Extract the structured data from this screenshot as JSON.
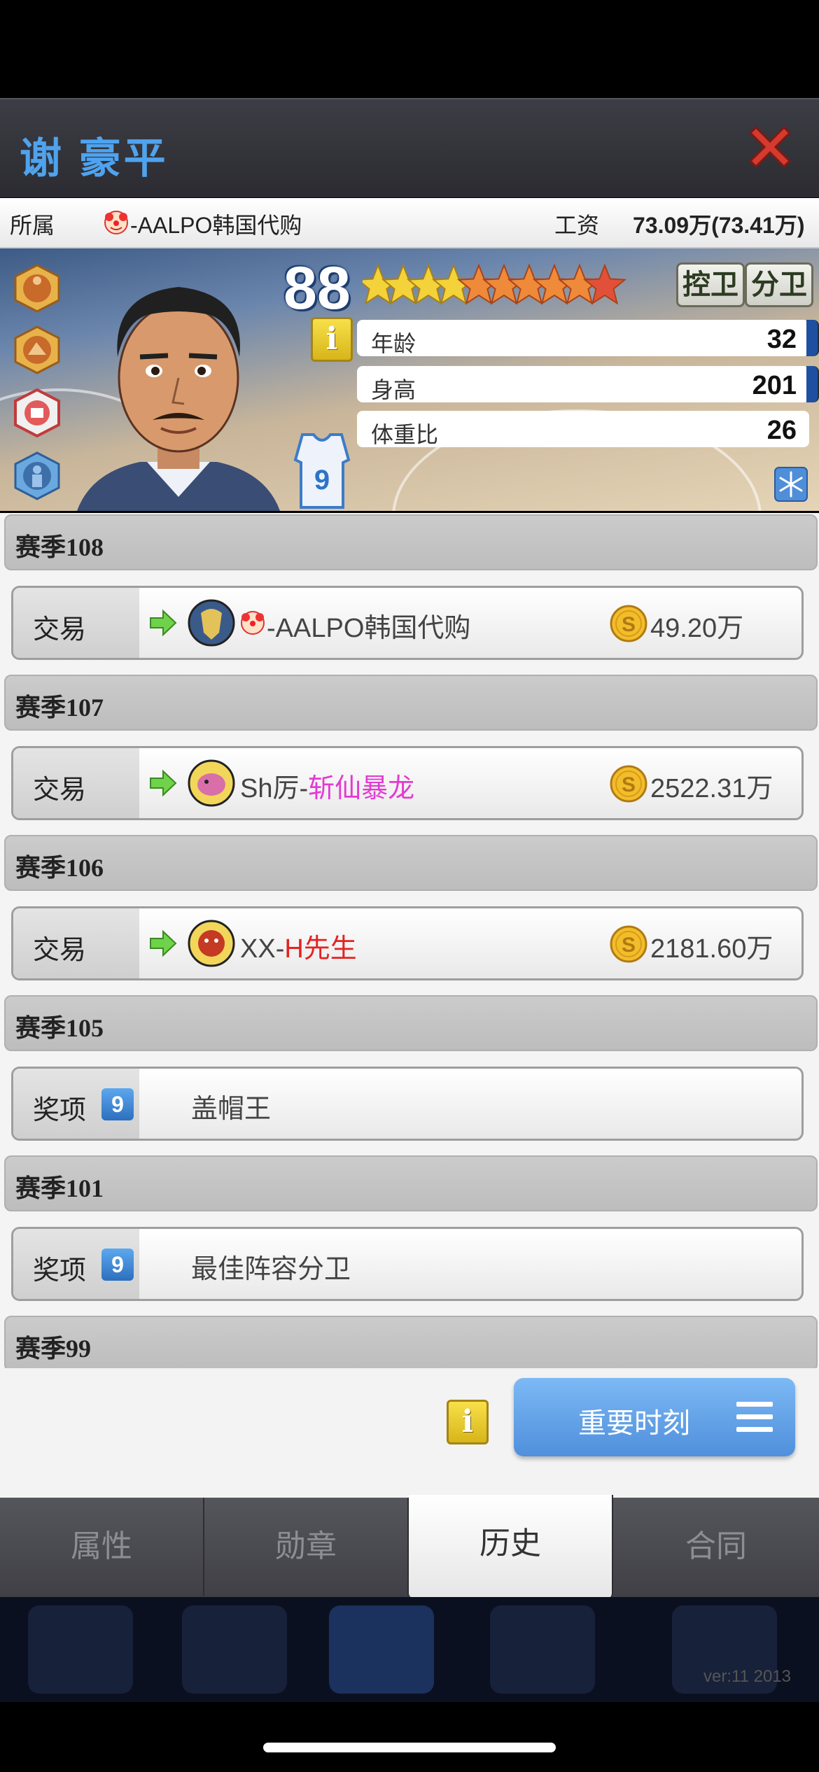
{
  "header": {
    "title": "谢 豪平",
    "close_icon": "close-x-icon"
  },
  "info": {
    "team_label": "所属",
    "team_name": "-AALPO韩国代购",
    "salary_label": "工资",
    "salary_value": "73.09万(73.41万)"
  },
  "player": {
    "overall": "88",
    "stars_total": 10,
    "positions": [
      "控卫",
      "分卫"
    ],
    "jersey_number": "9",
    "stats": [
      {
        "label": "年龄",
        "value": "32"
      },
      {
        "label": "身高",
        "value": "201"
      },
      {
        "label": "体重比",
        "value": "26"
      }
    ],
    "info_icon": "info-icon",
    "freeze_icon": "snowflake-icon"
  },
  "history": [
    {
      "season": "赛季108",
      "type": "交易",
      "kind": "trade",
      "team_prefix": "",
      "team_name": "-AALPO韩国代购",
      "team_color": "#444444",
      "price": "49.20万",
      "has_clown": true
    },
    {
      "season": "赛季107",
      "type": "交易",
      "kind": "trade",
      "team_prefix": "Sh厉-",
      "team_name": "斩仙暴龙",
      "team_color": "#e23ad2",
      "price": "2522.31万",
      "has_clown": false
    },
    {
      "season": "赛季106",
      "type": "交易",
      "kind": "trade",
      "team_prefix": "XX-",
      "team_name": "H先生",
      "team_color": "#e52222",
      "price": "2181.60万",
      "has_clown": false
    },
    {
      "season": "赛季105",
      "type": "奖项",
      "kind": "award",
      "badge": "9",
      "award": "盖帽王"
    },
    {
      "season": "赛季101",
      "type": "奖项",
      "kind": "award",
      "badge": "9",
      "award": "最佳阵容分卫"
    },
    {
      "season": "赛季99"
    }
  ],
  "footer": {
    "moment_label": "重要时刻"
  },
  "tabs": [
    {
      "label": "属性",
      "active": false
    },
    {
      "label": "勋章",
      "active": false
    },
    {
      "label": "历史",
      "active": true
    },
    {
      "label": "合同",
      "active": false
    }
  ],
  "version": "ver:11  2013"
}
